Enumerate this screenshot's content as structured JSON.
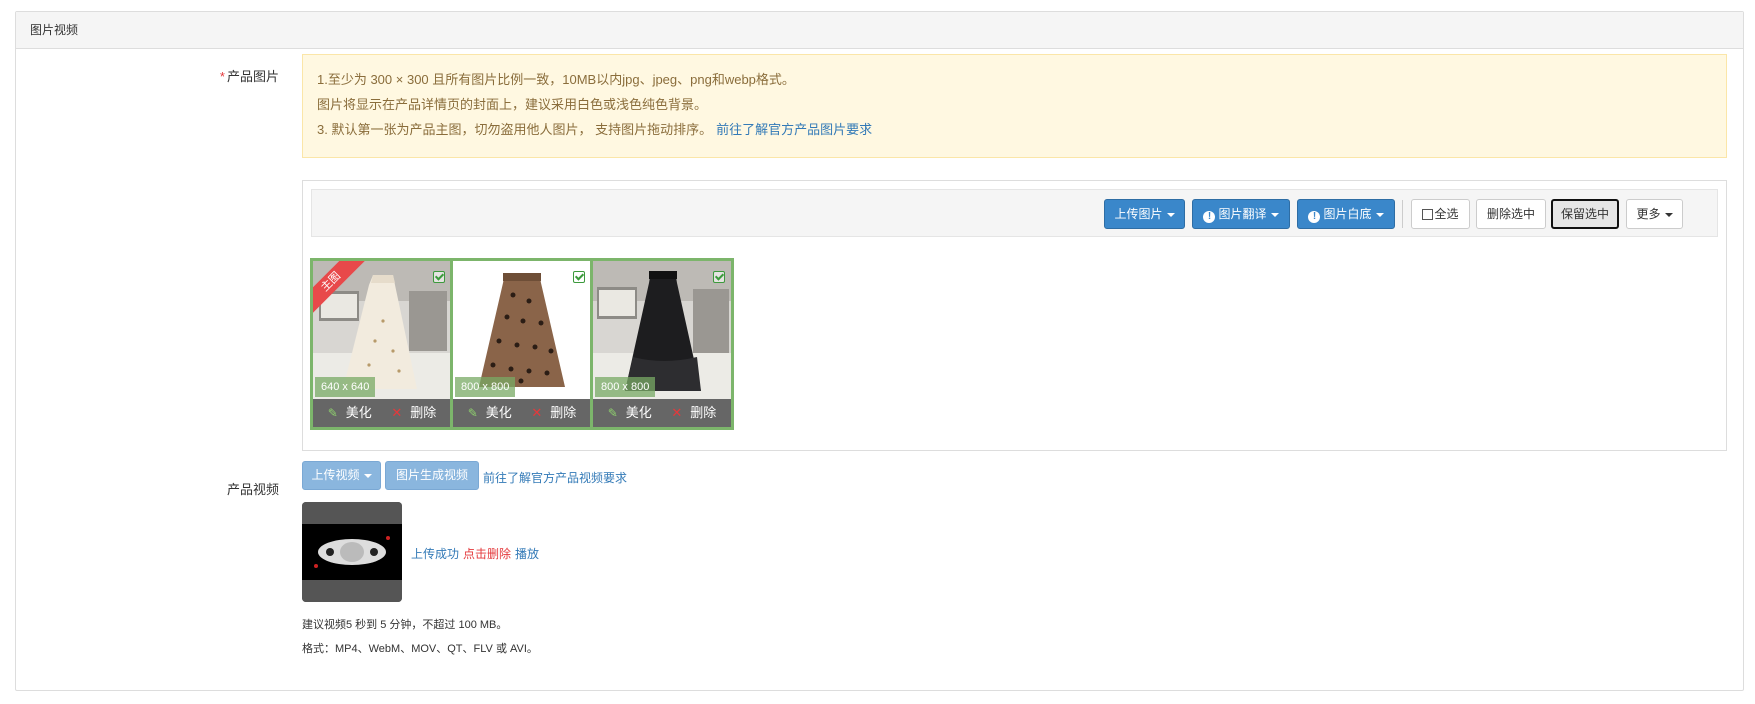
{
  "section": {
    "title": "图片视频"
  },
  "product_images": {
    "required_mark": "*",
    "label": "产品图片",
    "notice": [
      "1.至少为 300 × 300 且所有图片比例一致，10MB以内jpg、jpeg、png和webp格式。",
      "图片将显示在产品详情页的封面上，建议采用白色或浅色纯色背景。",
      "3. 默认第一张为产品主图，切勿盗用他人图片， 支持图片拖动排序。"
    ],
    "notice_link": "前往了解官方产品图片要求",
    "toolbar": {
      "upload": "上传图片",
      "translate": "图片翻译",
      "white_bg": "图片白底",
      "select_all": "全选",
      "delete_selected": "删除选中",
      "keep_selected": "保留选中",
      "more": "更多"
    },
    "thumbnails": [
      {
        "badge": "主图",
        "size": "640 x 640",
        "beautify": "美化",
        "delete": "删除"
      },
      {
        "badge": "",
        "size": "800 x 800",
        "beautify": "美化",
        "delete": "删除"
      },
      {
        "badge": "",
        "size": "800 x 800",
        "beautify": "美化",
        "delete": "删除"
      }
    ]
  },
  "product_video": {
    "label": "产品视频",
    "upload": "上传视频",
    "generate": "图片生成视频",
    "link": "前往了解官方产品视频要求",
    "status": "上传成功",
    "delete": "点击删除",
    "play": "播放",
    "note1": "建议视频5 秒到 5 分钟，不超过 100 MB。",
    "note2": "格式：MP4、WebM、MOV、QT、FLV 或 AVI。"
  },
  "colors": {
    "primary": "#3a87ca",
    "success_border": "#7cb56b",
    "danger": "#e4393c",
    "notice_bg": "#fff8e1"
  }
}
